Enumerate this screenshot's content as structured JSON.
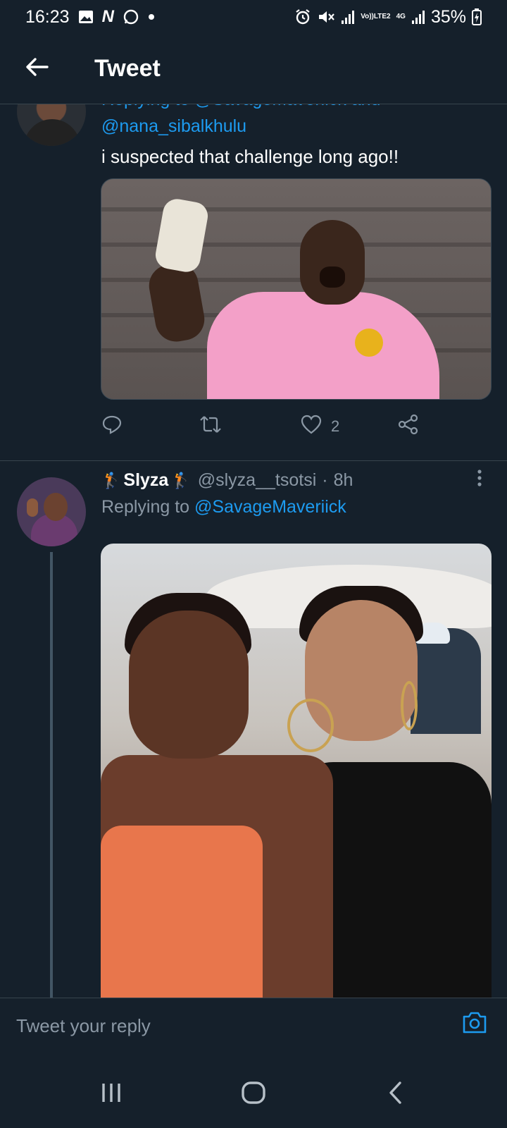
{
  "status_bar": {
    "time": "16:23",
    "left_icons": [
      "gallery-icon",
      "n-notification-icon",
      "whatsapp-icon"
    ],
    "battery": "35%",
    "network": "4G",
    "volte": "Vo))",
    "lte_label": "LTE2"
  },
  "header": {
    "title": "Tweet"
  },
  "tweet1": {
    "replying_clipped": "Replying to @SavageMaveriick and",
    "mention": "@nana_sibalkhulu",
    "text": "i suspected that challenge long ago!!",
    "likes": "2"
  },
  "tweet2": {
    "display_name": "Slyza",
    "name_emoji": "🏌",
    "handle": "@slyza__tsotsi",
    "separator": "·",
    "time": "8h",
    "replying_prefix": "Replying to",
    "replying_mention": "@SavageMaveriick"
  },
  "reply_bar": {
    "placeholder": "Tweet your reply"
  },
  "colors": {
    "background": "#15202b",
    "accent": "#1d9bf0",
    "secondary_text": "#8b98a5",
    "divider": "#38444d"
  }
}
